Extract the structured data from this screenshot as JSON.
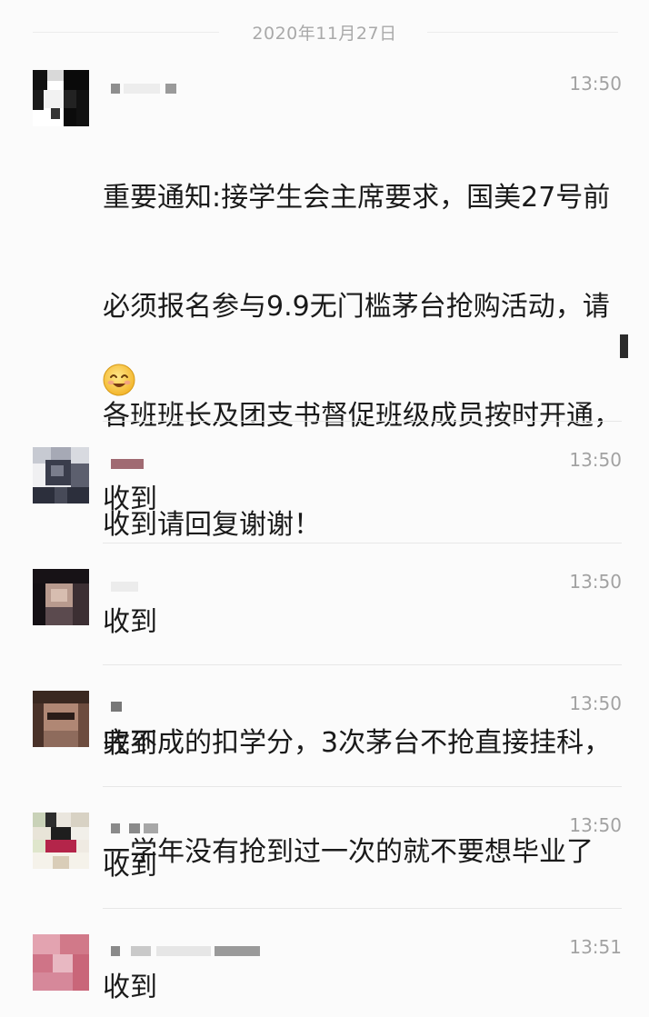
{
  "chat": {
    "date": "2020年11月27日",
    "messages": [
      {
        "time": "13:50",
        "text_lines": [
          "重要通知:接学生会主席要求，国美27号前",
          "必须报名参与9.9无门槛茅台抢购活动，请",
          "各班班长及团支书督促班级成员按时开通，",
          "收到请回复谢谢！",
          "",
          "完不成的扣学分，3次茅台不抢直接挂科，",
          "一学年没有抢到过一次的就不要想毕业了"
        ],
        "emoji": "smiling-face-emoji"
      },
      {
        "time": "13:50",
        "text": "收到"
      },
      {
        "time": "13:50",
        "text": "收到"
      },
      {
        "time": "13:50",
        "text": "收到"
      },
      {
        "time": "13:50",
        "text": "收到"
      },
      {
        "time": "13:51",
        "text": "收到"
      }
    ]
  }
}
